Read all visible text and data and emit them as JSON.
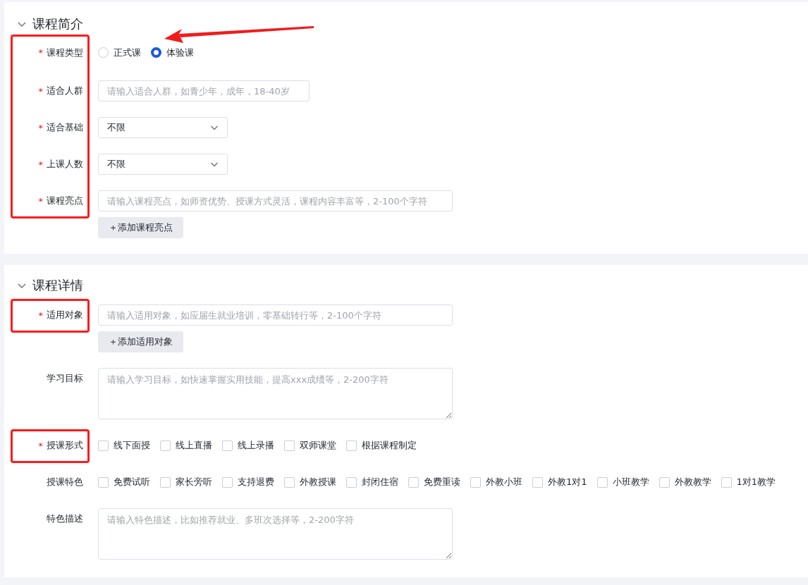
{
  "sections": [
    {
      "title": "课程简介",
      "expanded": true,
      "fields": [
        {
          "kind": "radio",
          "label": "课程类型",
          "required_mark": "*",
          "annotated": true,
          "arrow": true,
          "options": [
            {
              "label": "正式课",
              "selected": false
            },
            {
              "label": "体验课",
              "selected": true
            }
          ]
        },
        {
          "kind": "short_input",
          "label": "适合人群",
          "required_mark": "*",
          "annotated": true,
          "placeholder": "请输入适合人群，如青少年，成年，18-40岁"
        },
        {
          "kind": "select",
          "label": "适合基础",
          "required_mark": "*",
          "annotated": true,
          "value": "不限"
        },
        {
          "kind": "select",
          "label": "上课人数",
          "required_mark": "*",
          "annotated": true,
          "value": "不限"
        },
        {
          "kind": "input",
          "label": "课程亮点",
          "required_mark": "*",
          "annotated": true,
          "placeholder": "请输入课程亮点，如师资优势、授课方式灵活，课程内容丰富等，2-100个字符",
          "add_button": "＋添加课程亮点"
        }
      ]
    },
    {
      "title": "课程详情",
      "expanded": true,
      "fields": [
        {
          "kind": "input",
          "label": "适用对象",
          "required_mark": "*",
          "annotated": true,
          "placeholder": "请输入适用对象，如应届生就业培训，零基础转行等，2-100个字符",
          "add_button": "＋添加适用对象"
        },
        {
          "kind": "textarea",
          "label": "学习目标",
          "annotated": false,
          "placeholder": "请输入学习目标，如快速掌握实用技能，提高xxx成绩等，2-200字符"
        },
        {
          "kind": "checkbox",
          "label": "授课形式",
          "required_mark": "*",
          "annotated": true,
          "options": [
            {
              "label": "线下面授",
              "checked": false
            },
            {
              "label": "线上直播",
              "checked": false
            },
            {
              "label": "线上录播",
              "checked": false
            },
            {
              "label": "双师课堂",
              "checked": false
            },
            {
              "label": "根据课程制定",
              "checked": false
            }
          ]
        },
        {
          "kind": "checkbox",
          "label": "授课特色",
          "annotated": false,
          "options": [
            {
              "label": "免费试听",
              "checked": false
            },
            {
              "label": "家长旁听",
              "checked": false
            },
            {
              "label": "支持退费",
              "checked": false
            },
            {
              "label": "外教授课",
              "checked": false
            },
            {
              "label": "封闭住宿",
              "checked": false
            },
            {
              "label": "免费重读",
              "checked": false
            },
            {
              "label": "外教小班",
              "checked": false
            },
            {
              "label": "外教1对1",
              "checked": false
            },
            {
              "label": "小班教学",
              "checked": false
            },
            {
              "label": "外教教学",
              "checked": false
            },
            {
              "label": "1对1教学",
              "checked": false
            }
          ]
        },
        {
          "kind": "textarea",
          "label": "特色描述",
          "annotated": false,
          "placeholder": "请输入特色描述，比如推荐就业、多班次选择等，2-200字符"
        }
      ]
    }
  ]
}
